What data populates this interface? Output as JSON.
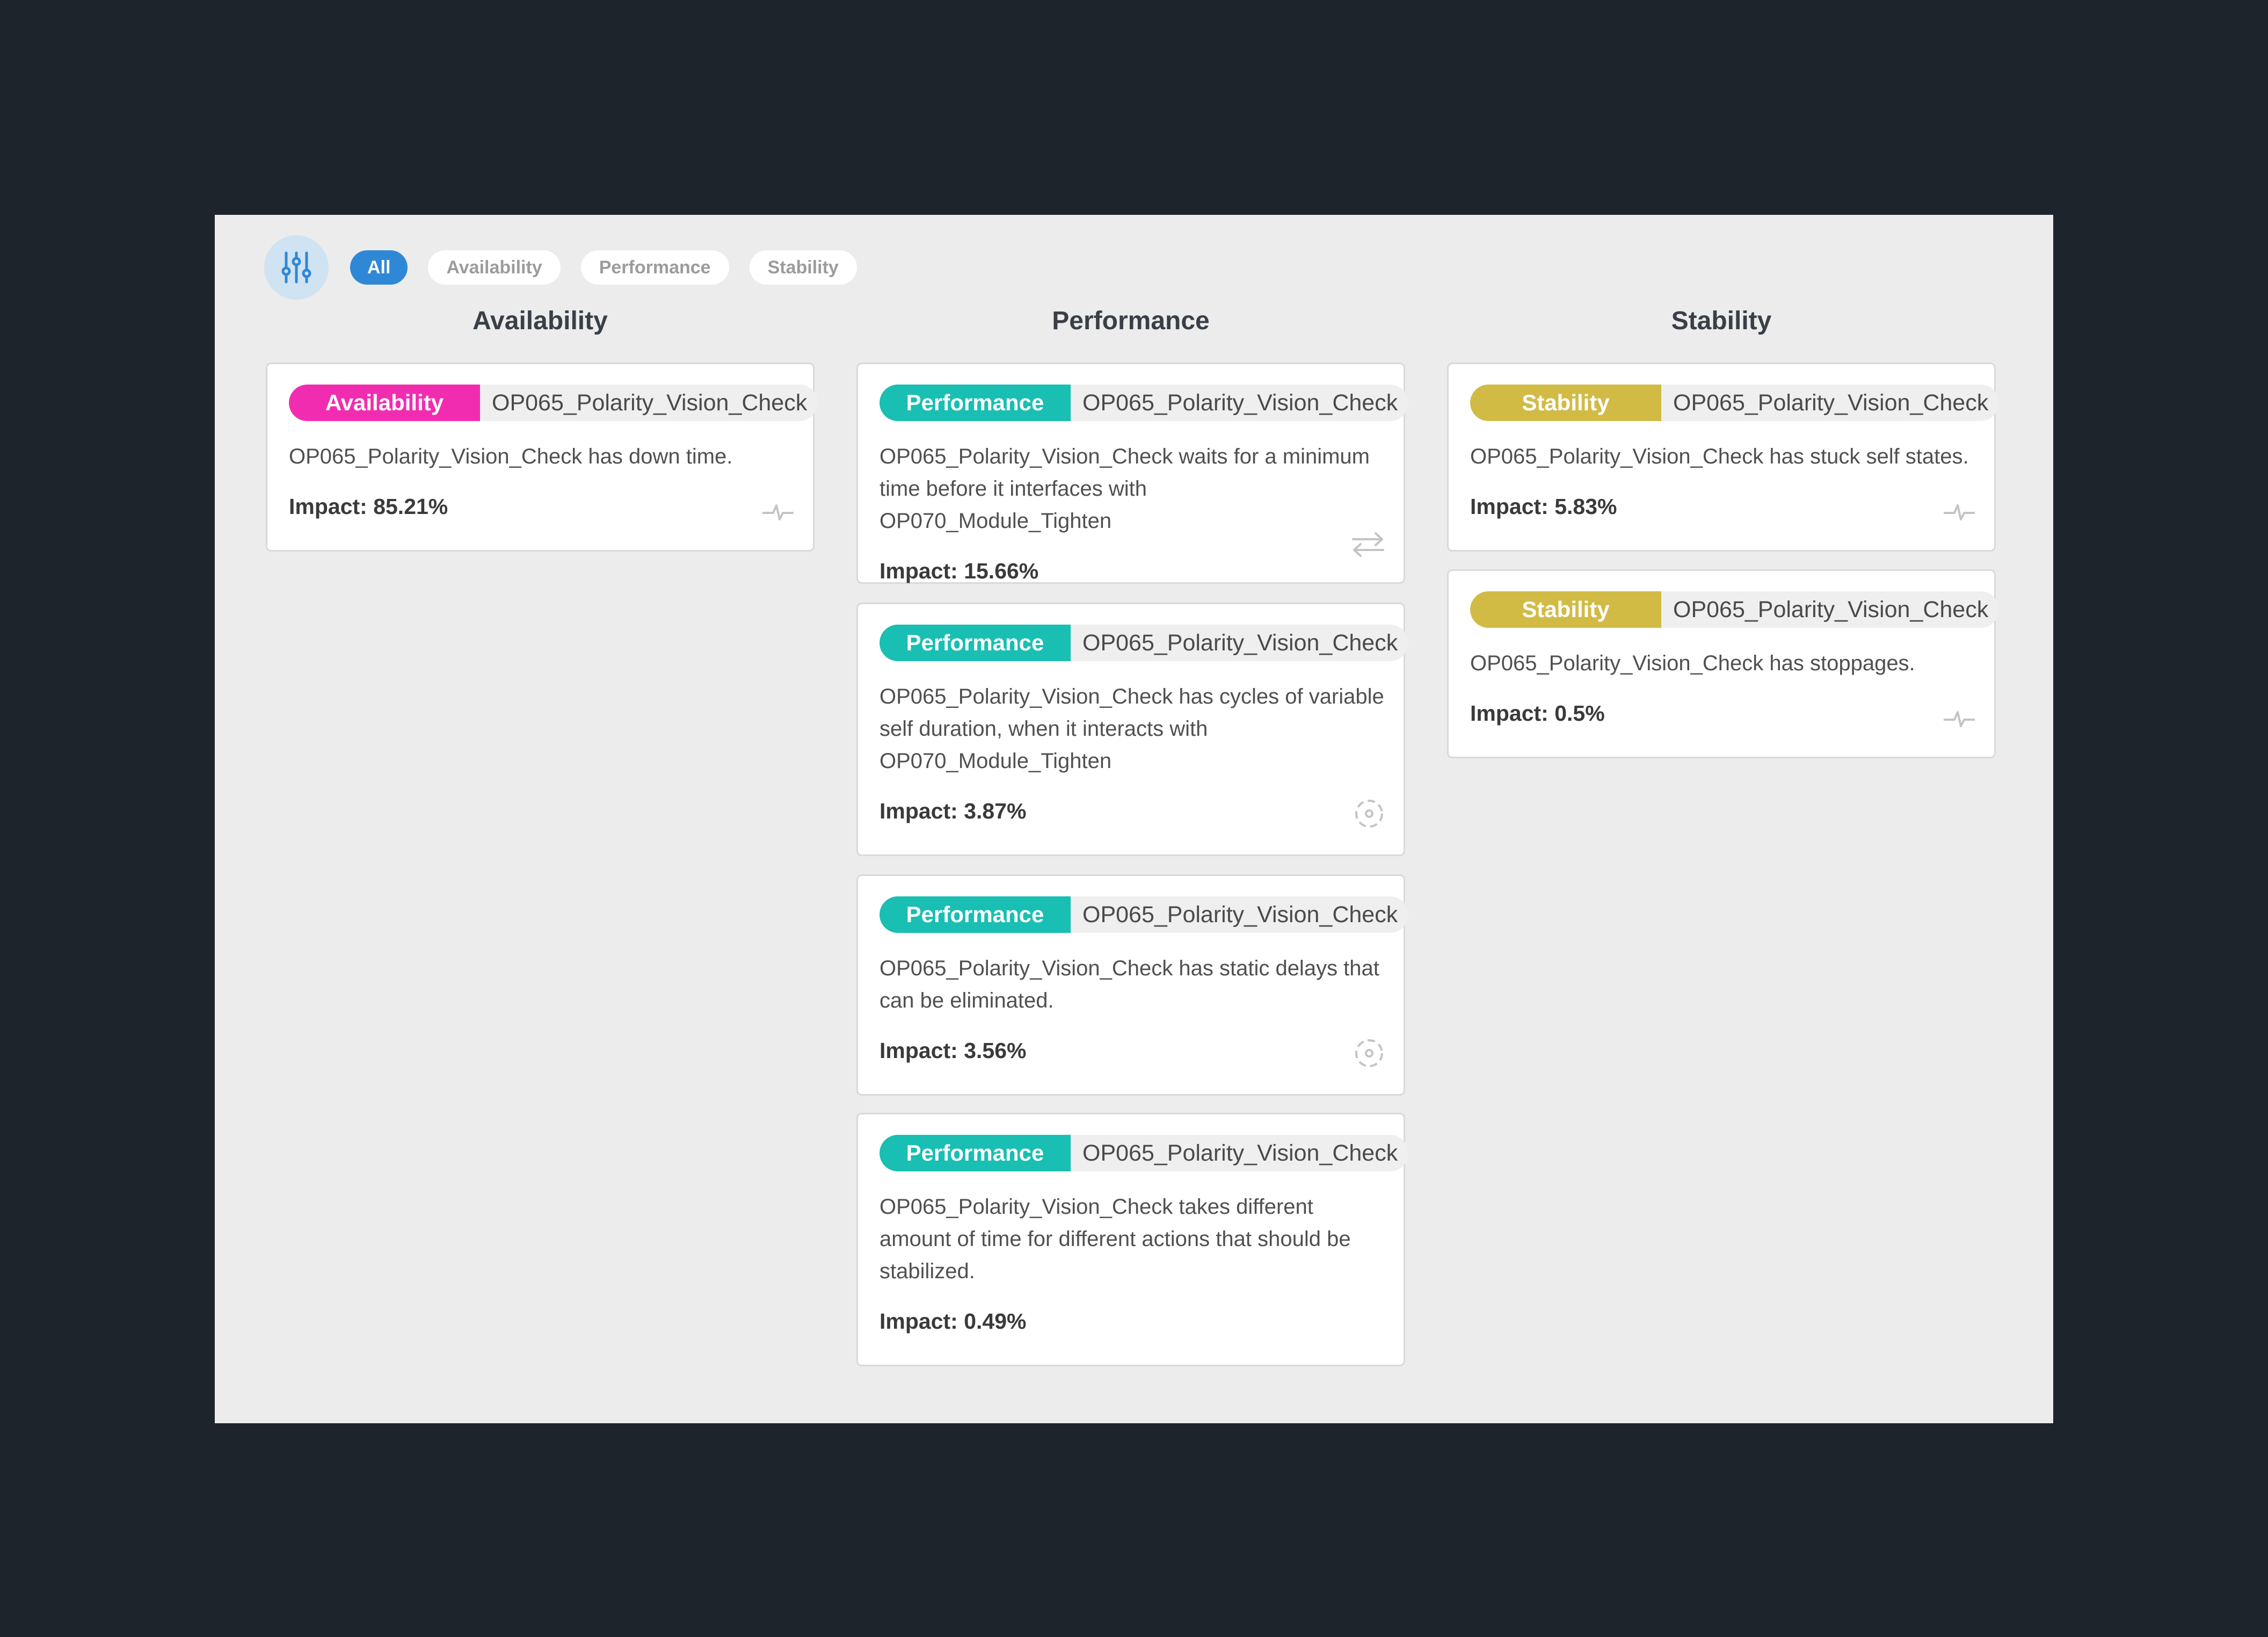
{
  "filter": {
    "chips": [
      "All",
      "Availability",
      "Performance",
      "Stability"
    ],
    "active": "All"
  },
  "columns": [
    {
      "title": "Availability",
      "cards": [
        {
          "tag": "Availability",
          "station": "OP065_Polarity_Vision_Check",
          "description": "OP065_Polarity_Vision_Check has down time.",
          "impact": "Impact: 85.21%",
          "icon": "pulse-icon"
        }
      ]
    },
    {
      "title": "Performance",
      "cards": [
        {
          "tag": "Performance",
          "station": "OP065_Polarity_Vision_Check",
          "description": "OP065_Polarity_Vision_Check waits for a minimum time before it interfaces with OP070_Module_Tighten",
          "impact": "Impact: 15.66%",
          "icon": "transfer-arrows-icon"
        },
        {
          "tag": "Performance",
          "station": "OP065_Polarity_Vision_Check",
          "description": "OP065_Polarity_Vision_Check has cycles of variable self duration, when it interacts with OP070_Module_Tighten",
          "impact": "Impact: 3.87%",
          "icon": "focus-target-icon"
        },
        {
          "tag": "Performance",
          "station": "OP065_Polarity_Vision_Check",
          "description": "OP065_Polarity_Vision_Check has static delays that can be eliminated.",
          "impact": "Impact: 3.56%",
          "icon": "focus-target-icon"
        },
        {
          "tag": "Performance",
          "station": "OP065_Polarity_Vision_Check",
          "description": "OP065_Polarity_Vision_Check takes different amount of time for different actions that should be stabilized.",
          "impact": "Impact: 0.49%",
          "icon": ""
        }
      ]
    },
    {
      "title": "Stability",
      "cards": [
        {
          "tag": "Stability",
          "station": "OP065_Polarity_Vision_Check",
          "description": "OP065_Polarity_Vision_Check has stuck self states.",
          "impact": "Impact: 5.83%",
          "icon": "pulse-icon"
        },
        {
          "tag": "Stability",
          "station": "OP065_Polarity_Vision_Check",
          "description": "OP065_Polarity_Vision_Check has stoppages.",
          "impact": "Impact: 0.5%",
          "icon": "pulse-icon"
        }
      ]
    }
  ],
  "colors": {
    "availability": "#f22cb0",
    "performance": "#18bfb2",
    "stability": "#d1bb45",
    "accent": "#2f88d6"
  }
}
